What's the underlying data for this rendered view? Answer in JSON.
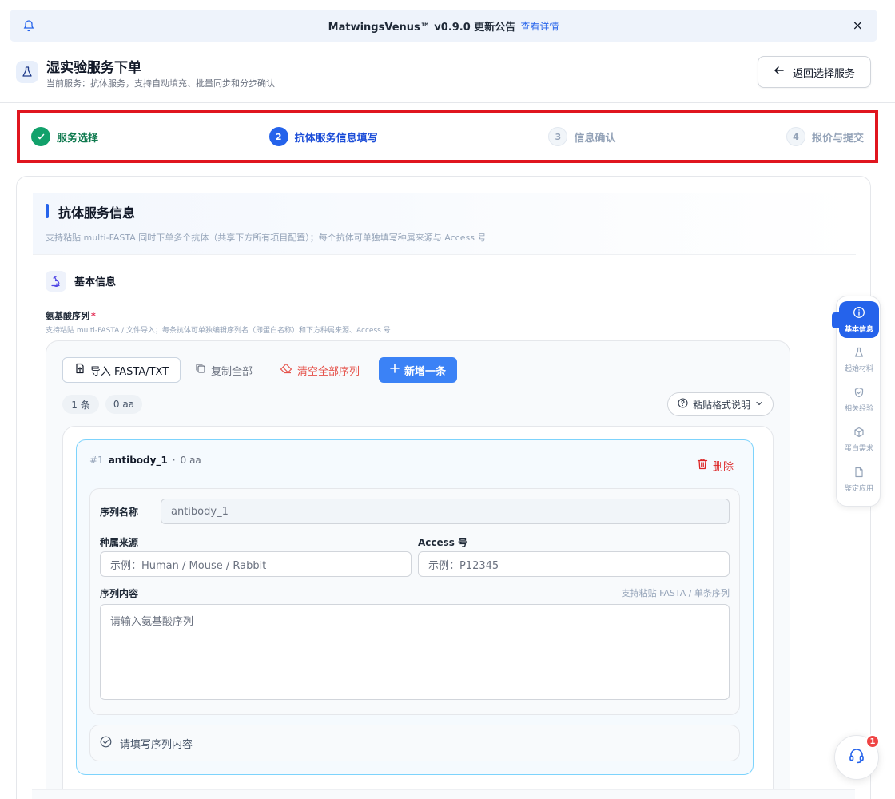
{
  "announcement": {
    "text": "MatwingsVenus™ v0.9.0 更新公告",
    "link": "查看详情",
    "close": "×"
  },
  "header": {
    "title": "湿实验服务下单",
    "subtitle": "当前服务：抗体服务，支持自动填充、批量同步和分步确认",
    "back_label": "返回选择服务"
  },
  "steps": [
    {
      "num": "1",
      "label": "服务选择",
      "state": "done"
    },
    {
      "num": "2",
      "label": "抗体服务信息填写",
      "state": "active"
    },
    {
      "num": "3",
      "label": "信息确认",
      "state": "todo"
    },
    {
      "num": "4",
      "label": "报价与提交",
      "state": "todo"
    }
  ],
  "section": {
    "title": "抗体服务信息",
    "desc": "支持粘贴 multi-FASTA 同时下单多个抗体（共享下方所有项目配置）；每个抗体可单独填写种属来源与 Access 号"
  },
  "basic": {
    "title": "基本信息"
  },
  "sequence_field": {
    "label": "氨基酸序列",
    "required_mark": "*",
    "hint": "支持粘贴 multi-FASTA / 文件导入；每条抗体可单独编辑序列名（即蛋白名称）和下方种属来源、Access 号"
  },
  "toolbar": {
    "import": "导入 FASTA/TXT",
    "copy": "复制全部",
    "clear": "清空全部序列",
    "add": "新增一条",
    "count": "1 条",
    "total_aa": "0 aa",
    "format_help": "粘贴格式说明"
  },
  "antibody": {
    "index": "#1",
    "name": "antibody_1",
    "sep": "·",
    "aa": "0 aa",
    "delete": "删除",
    "name_label": "序列名称",
    "name_value": "antibody_1",
    "species_label": "种属来源",
    "species_placeholder": "示例：Human / Mouse / Rabbit",
    "access_label": "Access 号",
    "access_placeholder": "示例：P12345",
    "content_label": "序列内容",
    "content_hint": "支持粘贴 FASTA / 单条序列",
    "content_placeholder": "请输入氨基酸序列",
    "status": "请填写序列内容"
  },
  "side_nav": [
    {
      "label": "基本信息",
      "icon": "info-icon",
      "active": true
    },
    {
      "label": "起始材料",
      "icon": "flask-icon",
      "active": false
    },
    {
      "label": "相关经验",
      "icon": "shield-icon",
      "active": false
    },
    {
      "label": "蛋白需求",
      "icon": "box-icon",
      "active": false
    },
    {
      "label": "鉴定应用",
      "icon": "document-icon",
      "active": false
    }
  ],
  "help": {
    "badge": "1"
  },
  "colors": {
    "primary": "#2563eb",
    "success": "#12a16b",
    "danger": "#dc2626",
    "highlight_border": "#e0161f"
  }
}
